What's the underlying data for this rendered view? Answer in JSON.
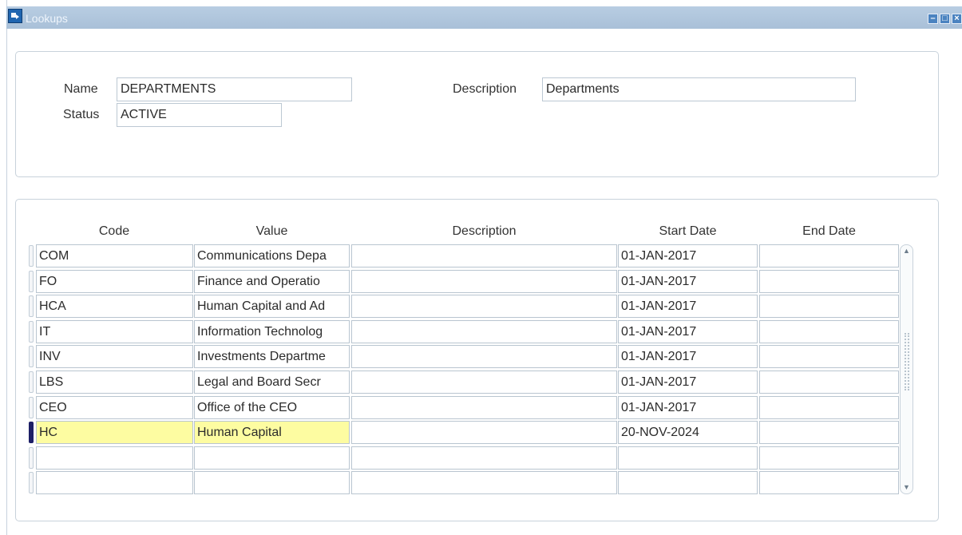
{
  "window": {
    "title": "Lookups"
  },
  "header": {
    "name_label": "Name",
    "name_value": "DEPARTMENTS",
    "status_label": "Status",
    "status_value": "ACTIVE",
    "description_label": "Description",
    "description_value": "Departments"
  },
  "grid": {
    "columns": [
      "Code",
      "Value",
      "Description",
      "Start Date",
      "End Date"
    ],
    "rows": [
      {
        "code": "COM",
        "value": "Communications Depa",
        "description": "",
        "start_date": "01-JAN-2017",
        "end_date": ""
      },
      {
        "code": "FO",
        "value": "Finance and Operatio",
        "description": "",
        "start_date": "01-JAN-2017",
        "end_date": ""
      },
      {
        "code": "HCA",
        "value": "Human Capital and Ad",
        "description": "",
        "start_date": "01-JAN-2017",
        "end_date": ""
      },
      {
        "code": "IT",
        "value": "Information Technolog",
        "description": "",
        "start_date": "01-JAN-2017",
        "end_date": ""
      },
      {
        "code": "INV",
        "value": "Investments Departme",
        "description": "",
        "start_date": "01-JAN-2017",
        "end_date": ""
      },
      {
        "code": "LBS",
        "value": "Legal and Board Secr",
        "description": "",
        "start_date": "01-JAN-2017",
        "end_date": ""
      },
      {
        "code": "CEO",
        "value": "Office of the CEO",
        "description": "",
        "start_date": "01-JAN-2017",
        "end_date": ""
      },
      {
        "code": "HC",
        "value": "Human Capital",
        "description": "",
        "start_date": "20-NOV-2024",
        "end_date": ""
      },
      {
        "code": "",
        "value": "",
        "description": "",
        "start_date": "",
        "end_date": ""
      },
      {
        "code": "",
        "value": "",
        "description": "",
        "start_date": "",
        "end_date": ""
      }
    ],
    "current_row": 7
  },
  "colors": {
    "highlight": "#fdfca1",
    "current_indicator": "#1d1f66"
  },
  "icons": {
    "app": "form-icon",
    "minimize": "minimize-icon",
    "maximize": "maximize-icon",
    "close": "close-icon"
  }
}
